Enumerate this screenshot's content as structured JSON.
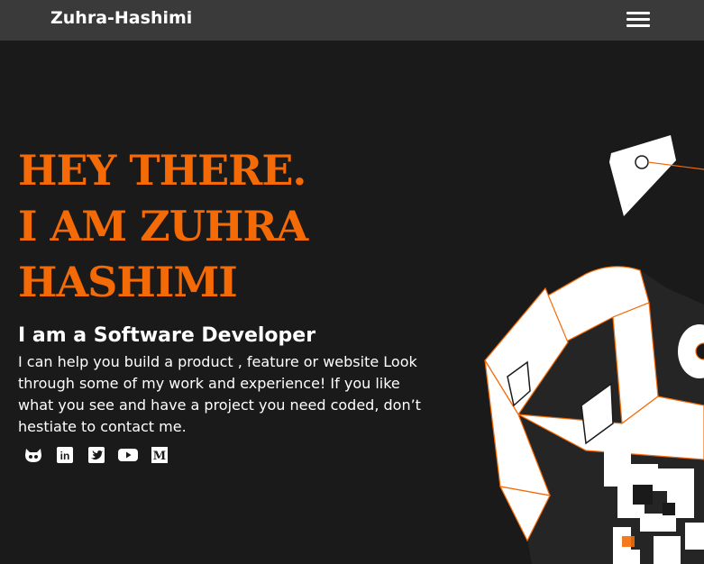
{
  "nav": {
    "brand": "Zuhra-Hashimi",
    "menu_icon": "hamburger-menu-icon"
  },
  "hero": {
    "title_lines": [
      "HEY THERE.",
      "I AM ZUHRA",
      "HASHIMI"
    ],
    "subtitle": "I am a Software Developer",
    "description": "I can help you build a product , feature or website Look through some of my work and experience! If you like what you see and have a project you need coded, don’t hestiate to contact me."
  },
  "socials": [
    {
      "icon": "github-icon"
    },
    {
      "icon": "linkedin-icon",
      "glyph": "in"
    },
    {
      "icon": "twitter-icon"
    },
    {
      "icon": "youtube-icon"
    },
    {
      "icon": "medium-icon",
      "glyph": "M"
    }
  ],
  "colors": {
    "accent": "#f46a06",
    "background": "#1b1a1a",
    "navbar": "#3b3a3b",
    "text": "#ffffff"
  }
}
